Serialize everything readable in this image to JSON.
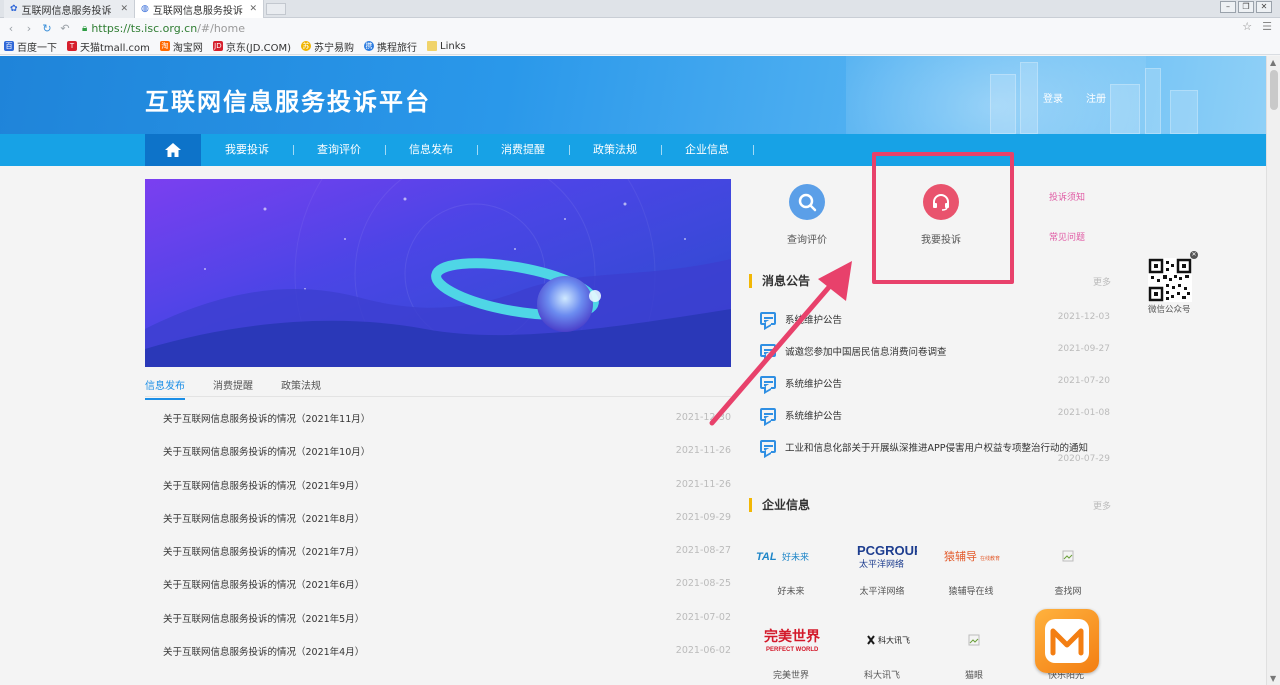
{
  "browser": {
    "tabs": [
      {
        "title": "互联网信息服务投诉"
      },
      {
        "title": "互联网信息服务投诉"
      }
    ],
    "url": {
      "host": "https://ts.isc.org.cn",
      "path": "/#/home"
    },
    "bookmarks": [
      {
        "label": "百度一下",
        "color": "#2f67d8"
      },
      {
        "label": "天猫tmall.com",
        "color": "#d6202d"
      },
      {
        "label": "淘宝网",
        "color": "#ff6a00"
      },
      {
        "label": "京东(JD.COM)",
        "color": "#d6202d"
      },
      {
        "label": "苏宁易购",
        "color": "#f0b400"
      },
      {
        "label": "携程旅行",
        "color": "#2a7be0"
      },
      {
        "label": "Links",
        "color": "#f0d36a"
      }
    ]
  },
  "header": {
    "title": "互联网信息服务投诉平台",
    "login": "登录",
    "register": "注册"
  },
  "nav": {
    "items": [
      "我要投诉",
      "查询评价",
      "信息发布",
      "消费提醒",
      "政策法规",
      "企业信息"
    ]
  },
  "subtabs": [
    "信息发布",
    "消费提醒",
    "政策法规"
  ],
  "news": [
    {
      "title": "关于互联网信息服务投诉的情况（2021年11月）",
      "date": "2021-12-30"
    },
    {
      "title": "关于互联网信息服务投诉的情况（2021年10月）",
      "date": "2021-11-26"
    },
    {
      "title": "关于互联网信息服务投诉的情况（2021年9月）",
      "date": "2021-11-26"
    },
    {
      "title": "关于互联网信息服务投诉的情况（2021年8月）",
      "date": "2021-09-29"
    },
    {
      "title": "关于互联网信息服务投诉的情况（2021年7月）",
      "date": "2021-08-27"
    },
    {
      "title": "关于互联网信息服务投诉的情况（2021年6月）",
      "date": "2021-08-25"
    },
    {
      "title": "关于互联网信息服务投诉的情况（2021年5月）",
      "date": "2021-07-02"
    },
    {
      "title": "关于互联网信息服务投诉的情况（2021年4月）",
      "date": "2021-06-02"
    }
  ],
  "quick": {
    "query": "查询评价",
    "complain": "我要投诉",
    "notice_link": "投诉须知",
    "faq_link": "常见问题"
  },
  "announcements": {
    "heading": "消息公告",
    "more": "更多",
    "items": [
      {
        "title": "系统维护公告",
        "date": "2021-12-03"
      },
      {
        "title": "诚邀您参加中国居民信息消费问卷调查",
        "date": "2021-09-27"
      },
      {
        "title": "系统维护公告",
        "date": "2021-07-20"
      },
      {
        "title": "系统维护公告",
        "date": "2021-01-08"
      },
      {
        "title": "工业和信息化部关于开展纵深推进APP侵害用户权益专项整治行动的通知",
        "date": "2020-07-29"
      }
    ]
  },
  "companies": {
    "heading": "企业信息",
    "more": "更多",
    "items": [
      {
        "name": "好未来",
        "logo_text": "TAL 好未来",
        "color": "#1f86c8"
      },
      {
        "name": "太平洋网络",
        "logo_text": "PCGROUP 太平洋网络",
        "color": "#1d3d8f"
      },
      {
        "name": "猿辅导在线",
        "logo_text": "猿辅导 在线教育",
        "color": "#e35b2c"
      },
      {
        "name": "查找网",
        "logo_text": "",
        "color": "#999999"
      },
      {
        "name": "完美世界",
        "logo_text": "完美世界 PERFECT WORLD",
        "color": "#d3192a"
      },
      {
        "name": "科大讯飞",
        "logo_text": "科大讯飞",
        "color": "#1a1a1a"
      },
      {
        "name": "猫眼",
        "logo_text": "",
        "color": "#999999"
      },
      {
        "name": "快乐阳光",
        "logo_text": "",
        "color": "#999999"
      }
    ]
  },
  "qr": {
    "label": "微信公众号"
  }
}
